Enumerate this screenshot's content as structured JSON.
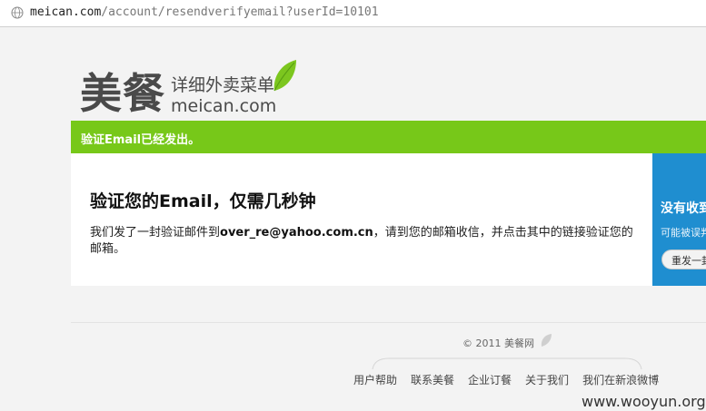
{
  "browser": {
    "url_domain": "meican.com",
    "url_path": "/account/resendverifyemail?userId=10101"
  },
  "logo": {
    "brand_cn": "美餐",
    "tagline": "详细外卖菜单",
    "domain": "meican.com"
  },
  "notice": {
    "text": "验证Email已经发出。"
  },
  "main": {
    "heading": "验证您的Email，仅需几秒钟",
    "message_prefix": "我们发了一封验证邮件到",
    "email": "over_re@yahoo.com.cn",
    "message_suffix": "，请到您的邮箱收信，并点击其中的链接验证您的邮箱。"
  },
  "side": {
    "title": "没有收到",
    "desc": "可能被误判",
    "button": "重发一封"
  },
  "footer": {
    "copyright": "© 2011 美餐网",
    "links": [
      "用户帮助",
      "联系美餐",
      "企业订餐",
      "关于我们",
      "我们在新浪微博"
    ]
  },
  "watermark": "www.wooyun.org",
  "colors": {
    "green": "#77c819",
    "blue": "#1f8ed0",
    "leaf": "#7cc61f"
  }
}
